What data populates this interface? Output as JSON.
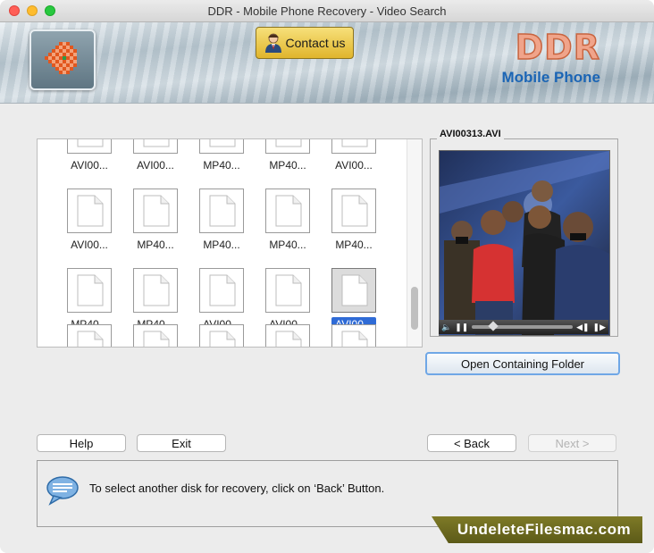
{
  "window": {
    "title": "DDR - Mobile Phone Recovery - Video Search"
  },
  "banner": {
    "contact_label": "Contact us",
    "brand_name": "DDR",
    "brand_product": "Mobile Phone"
  },
  "file_grid": {
    "rows": [
      [
        "AVI00...",
        "AVI00...",
        "MP40...",
        "MP40...",
        "AVI00..."
      ],
      [
        "AVI00...",
        "MP40...",
        "MP40...",
        "MP40...",
        "MP40..."
      ],
      [
        "MP40...",
        "MP40...",
        "AVI00...",
        "AVI00...",
        "AVI00..."
      ]
    ],
    "selected": {
      "row": 2,
      "col": 4
    }
  },
  "preview": {
    "title": "AVI00313.AVI"
  },
  "buttons": {
    "open_folder": "Open Containing Folder",
    "help": "Help",
    "exit": "Exit",
    "back": "< Back",
    "next": "Next >"
  },
  "status": {
    "message": "To select another disk for recovery, click on ‘Back’ Button."
  },
  "watermark": {
    "text": "UndeleteFilesmac.com"
  },
  "colors": {
    "selection": "#2f6bd6",
    "brand_orange": "#f0a48a",
    "brand_blue": "#1b65b5",
    "contact_gold": "#e0b52c"
  }
}
